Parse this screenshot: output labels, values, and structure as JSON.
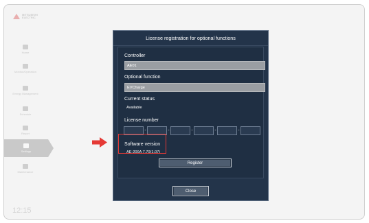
{
  "background": {
    "brand_logo_text": "MITSUBISHI ELECTRIC",
    "sidebar": {
      "items": [
        {
          "label": "Home",
          "icon": "home-icon"
        },
        {
          "label": "Monitor/Operation",
          "icon": "monitor-icon"
        },
        {
          "label": "Energy Management",
          "icon": "energy-icon"
        },
        {
          "label": "Schedule",
          "icon": "calendar-icon"
        },
        {
          "label": "Report",
          "icon": "report-icon"
        },
        {
          "label": "Settings",
          "icon": "gear-icon"
        },
        {
          "label": "Maintenance",
          "icon": "wrench-icon"
        }
      ]
    },
    "clock": "12:15"
  },
  "dialog": {
    "title": "License registration for optional functions",
    "controller_label": "Controller",
    "controller_value": "AE01",
    "optional_function_label": "Optional function",
    "optional_function_value": "EVCharge",
    "current_status_label": "Current status",
    "current_status_value": "Available",
    "license_number_label": "License number",
    "license_separators": [
      "-",
      "-",
      "-",
      "-",
      "-"
    ],
    "software_version_label": "Software version",
    "software_version_value": "AE-200A 7.70(1.07)",
    "register_button": "Register",
    "close_button": "Close"
  },
  "colors": {
    "dialog_bg": "#23344a",
    "field_bg": "#9a9ea3",
    "highlight": "#e53935",
    "arrow": "#e53935"
  }
}
